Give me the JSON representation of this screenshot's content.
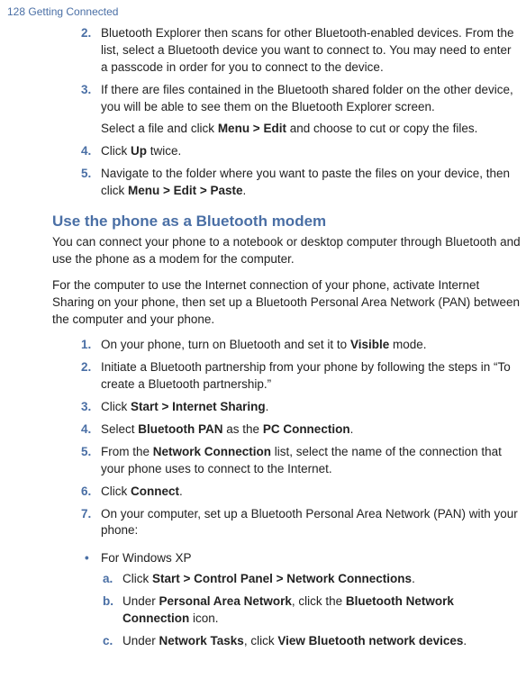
{
  "header": "128  Getting Connected",
  "steps1": [
    {
      "num": "2.",
      "text": "Bluetooth Explorer then scans for other Bluetooth-enabled devices. From the list, select a Bluetooth device you want to connect to. You may need to enter a passcode in order for you to connect to the device."
    },
    {
      "num": "3.",
      "text": "If there are files contained in the Bluetooth shared folder on the other device, you will be able to see them on the Bluetooth Explorer screen."
    },
    {
      "num": "4.",
      "html": "Click <b>Up</b> twice."
    },
    {
      "num": "5.",
      "html": "Navigate to the folder where you want to paste the files on your device, then click <b>Menu > Edit > Paste</b>."
    }
  ],
  "step3extra": "Select a file and click <b>Menu > Edit</b> and choose to cut or copy the files.",
  "sectionTitle": "Use the phone as a Bluetooth modem",
  "intro1": "You can connect your phone to a notebook or desktop computer through Bluetooth and use the phone as a modem for the computer.",
  "intro2": "For the computer to use the Internet connection of your phone, activate Internet Sharing on your phone, then set up a Bluetooth Personal Area Network (PAN) between the computer and your phone.",
  "steps2": [
    {
      "num": "1.",
      "html": "On your phone, turn on Bluetooth and set it to <b>Visible</b> mode."
    },
    {
      "num": "2.",
      "text": "Initiate a Bluetooth partnership from your phone by following the steps in “To create a Bluetooth partnership.”"
    },
    {
      "num": "3.",
      "html": "Click <b>Start > Internet Sharing</b>."
    },
    {
      "num": "4.",
      "html": "Select <b>Bluetooth PAN</b> as the <b>PC Connection</b>."
    },
    {
      "num": "5.",
      "html": "From the <b>Network Connection</b> list, select the name of the connection that your phone uses to connect to the Internet."
    },
    {
      "num": "6.",
      "html": "Click <b>Connect</b>."
    },
    {
      "num": "7.",
      "text": "On your computer, set up a Bluetooth Personal Area Network (PAN) with your phone:"
    }
  ],
  "bullet": "For Windows XP",
  "substeps": [
    {
      "num": "a.",
      "html": "Click <b>Start > Control Panel > Network Connections</b>."
    },
    {
      "num": "b.",
      "html": "Under <b>Personal Area Network</b>, click the <b>Bluetooth Network Connection</b> icon."
    },
    {
      "num": "c.",
      "html": "Under <b>Network Tasks</b>, click <b>View Bluetooth network devices</b>."
    }
  ]
}
